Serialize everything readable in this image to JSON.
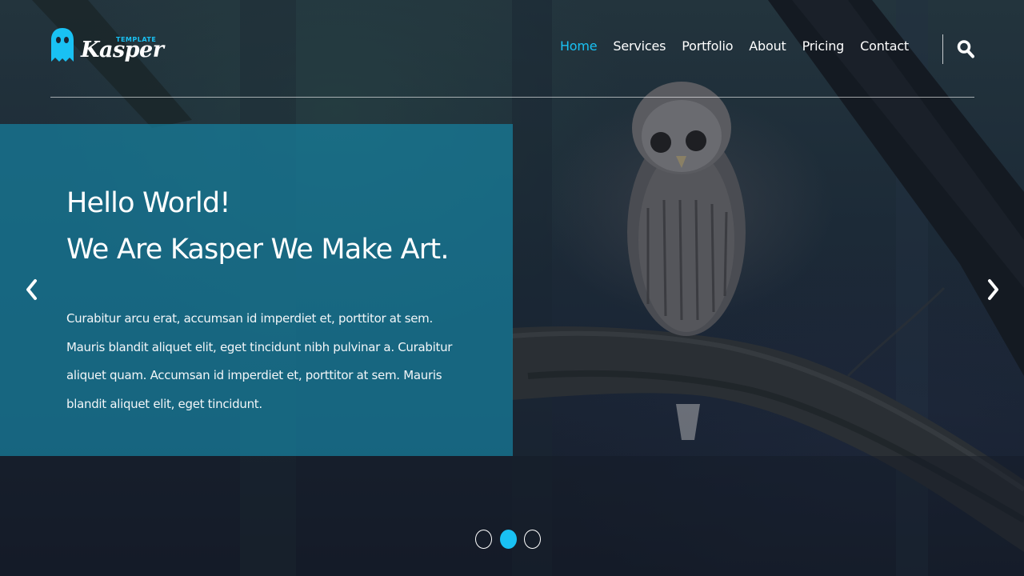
{
  "brand": {
    "name": "Kasper",
    "tag": "TEMPLATE",
    "accent_color": "#19c1f3",
    "icon": "ghost-icon"
  },
  "nav": {
    "items": [
      {
        "label": "Home",
        "active": true
      },
      {
        "label": "Services",
        "active": false
      },
      {
        "label": "Portfolio",
        "active": false
      },
      {
        "label": "About",
        "active": false
      },
      {
        "label": "Pricing",
        "active": false
      },
      {
        "label": "Contact",
        "active": false
      }
    ],
    "search_icon": "search-icon"
  },
  "hero": {
    "title_line1": "Hello World!",
    "title_line2": "We Are Kasper We Make Art.",
    "description": "Curabitur arcu erat, accumsan id imperdiet et, porttitor at sem. Mauris blandit aliquet elit, eget tincidunt nibh pulvinar a. Curabitur aliquet quam. Accumsan id imperdiet et, porttitor at sem. Mauris blandit aliquet elit, eget tincidunt.",
    "box_color": "#16809e",
    "prev_icon": "chevron-left-icon",
    "next_icon": "chevron-right-icon"
  },
  "slider": {
    "slide_count": 3,
    "active_index": 1
  }
}
